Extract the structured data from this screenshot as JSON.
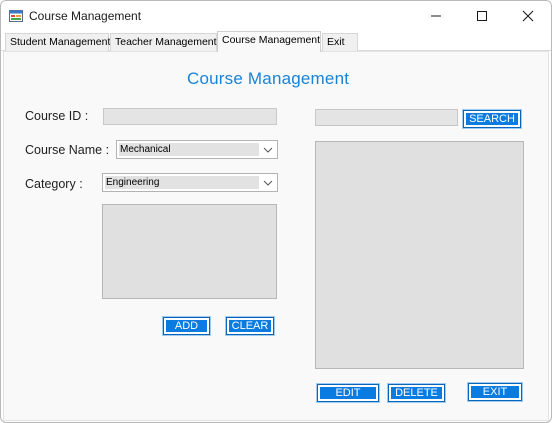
{
  "window": {
    "title": "Course Management"
  },
  "tabs": [
    {
      "label": "Student Management"
    },
    {
      "label": "Teacher Management"
    },
    {
      "label": "Course Management"
    },
    {
      "label": "Exit"
    }
  ],
  "active_tab": "Course Management",
  "form": {
    "heading": "Course Management",
    "course_id_label": "Course ID :",
    "course_id_value": "",
    "course_name_label": "Course Name :",
    "course_name_value": "Mechanical",
    "category_label": "Category :",
    "category_value": "Engineering"
  },
  "search": {
    "value": "",
    "button_label": "SEARCH"
  },
  "buttons": {
    "add": "ADD",
    "clear": "CLEAR",
    "edit": "EDIT",
    "delete": "DELETE",
    "exit": "EXIT"
  },
  "colors": {
    "accent": "#1a83d6",
    "button": "#0a7be0"
  },
  "icons": {
    "app": "app-form-icon",
    "minimize": "minimize-icon",
    "maximize": "maximize-icon",
    "close": "close-icon",
    "dropdown": "chevron-down-icon"
  }
}
